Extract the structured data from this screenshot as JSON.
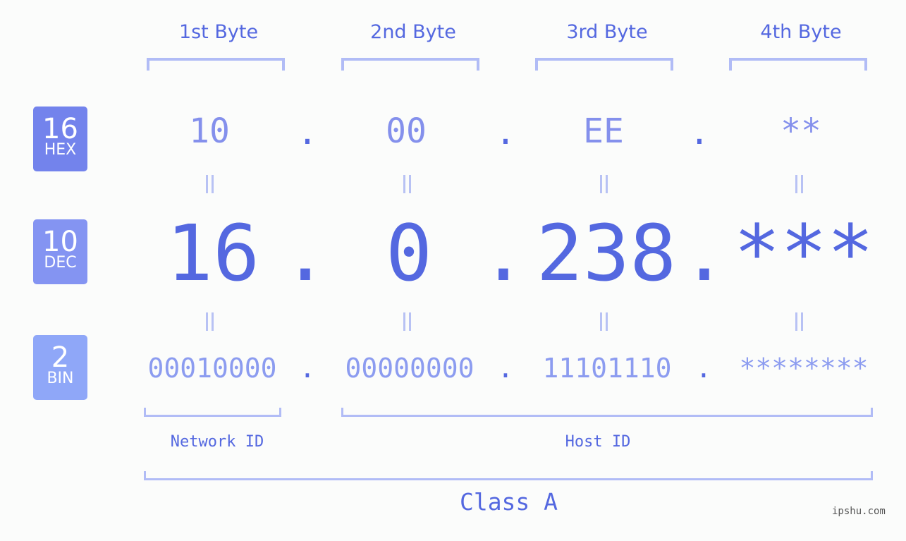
{
  "badges": [
    {
      "base": "16",
      "label": "HEX",
      "color": "#7383ec"
    },
    {
      "base": "10",
      "label": "DEC",
      "color": "#8494f2"
    },
    {
      "base": "2",
      "label": "BIN",
      "color": "#8fa7f8"
    }
  ],
  "byte_headers": [
    "1st Byte",
    "2nd Byte",
    "3rd Byte",
    "4th Byte"
  ],
  "hex": [
    "10",
    "00",
    "EE",
    "**"
  ],
  "dec": [
    "16",
    "0",
    "238",
    "***"
  ],
  "bin": [
    "00010000",
    "00000000",
    "11101110",
    "********"
  ],
  "separator": ".",
  "network_id_label": "Network ID",
  "host_id_label": "Host ID",
  "class_label": "Class A",
  "watermark": "ipshu.com",
  "colors": {
    "primary": "#5468e0",
    "hex_text": "#8490ec",
    "bin_text": "#8c9cf0",
    "bracket": "#b1bcf6",
    "background": "#fbfcfb"
  }
}
